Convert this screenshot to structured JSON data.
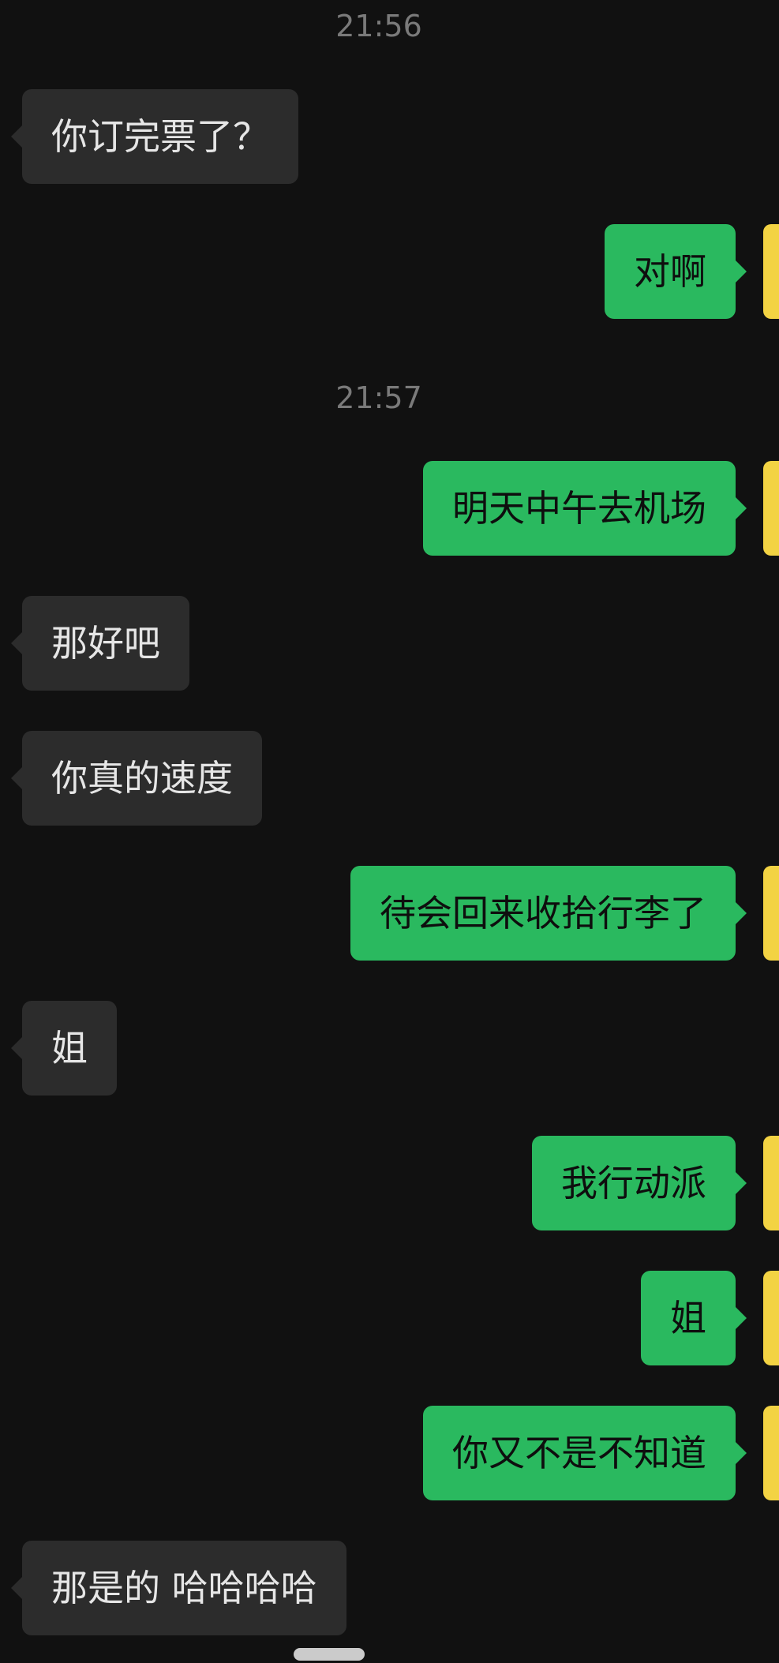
{
  "timestamps": [
    "21:56",
    "21:57"
  ],
  "messages": [
    {
      "side": "in",
      "text": "你订完票了？"
    },
    {
      "side": "out",
      "text": "对啊"
    },
    {
      "side": "out",
      "text": "明天中午去机场"
    },
    {
      "side": "in",
      "text": "那好吧"
    },
    {
      "side": "in",
      "text": "你真的速度"
    },
    {
      "side": "out",
      "text": "待会回来收拾行李了"
    },
    {
      "side": "in",
      "text": "姐"
    },
    {
      "side": "out",
      "text": "我行动派"
    },
    {
      "side": "out",
      "text": "姐"
    },
    {
      "side": "out",
      "text": "你又不是不知道"
    },
    {
      "side": "in",
      "text": "那是的 哈哈哈哈"
    }
  ],
  "colors": {
    "background": "#111111",
    "incoming_bubble": "#2c2c2c",
    "outgoing_bubble": "#2ab95f",
    "avatar": "#f3d343",
    "timestamp_text": "#7a7a7a"
  }
}
